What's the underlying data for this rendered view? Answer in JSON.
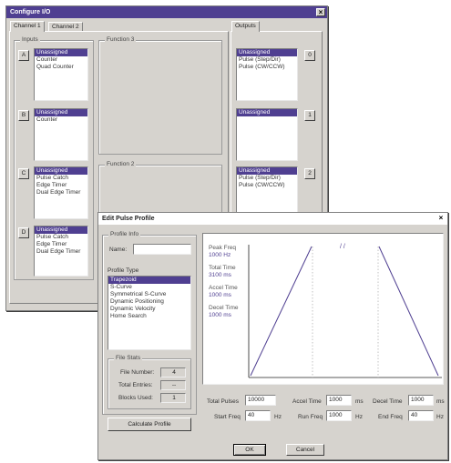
{
  "configure_window": {
    "title": "Configure I/O",
    "tabs": [
      "Channel 1",
      "Channel 2"
    ],
    "inputs_label": "Inputs",
    "outputs_label": "Outputs",
    "function3_label": "Function 3",
    "function2_label": "Function 2",
    "input_rows": [
      {
        "button": "A",
        "items": [
          "Unassigned",
          "Counter",
          "Quad Counter"
        ]
      },
      {
        "button": "B",
        "items": [
          "Unassigned",
          "Counter"
        ]
      },
      {
        "button": "C",
        "items": [
          "Unassigned",
          "Pulse Catch",
          "Edge Timer",
          "Dual Edge Timer"
        ]
      },
      {
        "button": "D",
        "items": [
          "Unassigned",
          "Pulse Catch",
          "Edge Timer",
          "Dual Edge Timer"
        ]
      }
    ],
    "output_rows": [
      {
        "button": "0",
        "items": [
          "Unassigned",
          "Pulse (Step/Dir)",
          "Pulse (CW/CCW)"
        ]
      },
      {
        "button": "1",
        "items": [
          "Unassigned"
        ]
      },
      {
        "button": "2",
        "items": [
          "Unassigned",
          "Pulse (Step/Dir)",
          "Pulse (CW/CCW)"
        ]
      }
    ]
  },
  "profile_window": {
    "title": "Edit Pulse Profile",
    "profile_info_label": "Profile Info",
    "name_label": "Name:",
    "name_value": "",
    "profile_type_label": "Profile Type",
    "profile_types": [
      "Trapezoid",
      "S-Curve",
      "Symmetrical S-Curve",
      "Dynamic Positioning",
      "Dynamic Velocity",
      "Home Search"
    ],
    "file_stats_label": "File Stats",
    "file_number_label": "File Number:",
    "file_number_value": "4",
    "total_entries_label": "Total Entries:",
    "total_entries_value": "--",
    "blocks_used_label": "Blocks Used:",
    "blocks_used_value": "1",
    "calculate_button": "Calculate Profile",
    "plot": {
      "peak_freq_label": "Peak Freq",
      "peak_freq_value": "1000 Hz",
      "total_time_label": "Total Time",
      "total_time_value": "3100 ms",
      "accel_time_label": "Accel Time",
      "accel_time_value": "1000 ms",
      "decel_time_label": "Decel Time",
      "decel_time_value": "1000 ms",
      "break_mark": "/ /"
    },
    "fields": {
      "total_pulses_label": "Total Pulses",
      "total_pulses_value": "10000",
      "accel_time_label": "Accel Time",
      "accel_time_value": "1000",
      "accel_unit": "ms",
      "decel_time_label": "Decel Time",
      "decel_time_value": "1000",
      "decel_unit": "ms",
      "start_freq_label": "Start Freq",
      "start_freq_value": "40",
      "start_unit": "Hz",
      "run_freq_label": "Run Freq",
      "run_freq_value": "1000",
      "run_unit": "Hz",
      "end_freq_label": "End Freq",
      "end_freq_value": "40",
      "end_unit": "Hz"
    },
    "ok_button": "OK",
    "cancel_button": "Cancel"
  },
  "colors": {
    "titlebar": "#4f3f91",
    "selection": "#4f3f91",
    "dialog_face": "#d6d3ce"
  }
}
